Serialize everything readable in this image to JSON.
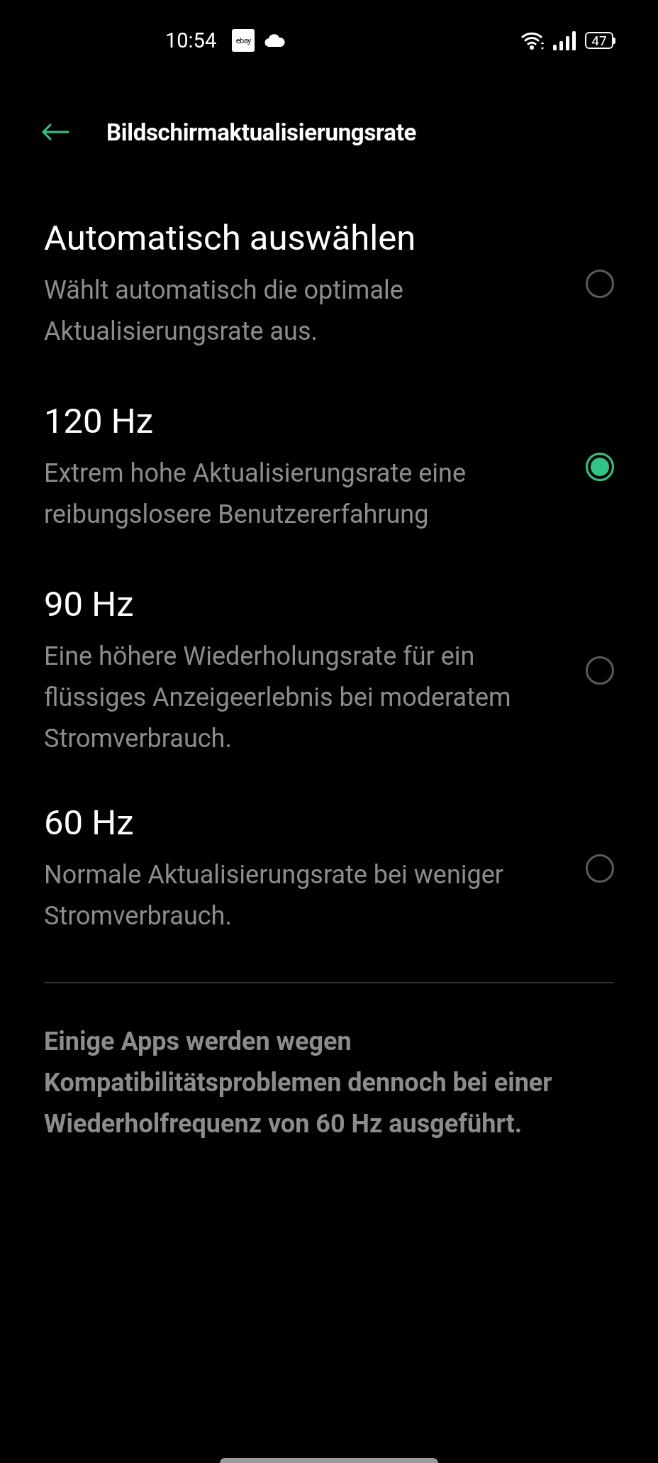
{
  "status_bar": {
    "time": "10:54",
    "app_badge": "ebay",
    "battery": "47"
  },
  "header": {
    "title": "Bildschirmaktualisierungsrate"
  },
  "options": [
    {
      "title": "Automatisch auswählen",
      "description": "Wählt automatisch die optimale Aktualisierungsrate aus.",
      "selected": false
    },
    {
      "title": "120 Hz",
      "description": "Extrem hohe Aktualisierungsrate eine reibungslosere Benutzererfahrung",
      "selected": true
    },
    {
      "title": "90 Hz",
      "description": "Eine höhere Wiederholungsrate für ein flüssiges Anzeigeerlebnis bei moderatem Stromverbrauch.",
      "selected": false
    },
    {
      "title": "60 Hz",
      "description": "Normale Aktualisierungsrate bei weniger Stromverbrauch.",
      "selected": false
    }
  ],
  "footer_note": "Einige Apps werden wegen Kompatibilitätsproblemen dennoch bei einer Wiederholfrequenz von 60 Hz ausgeführt."
}
